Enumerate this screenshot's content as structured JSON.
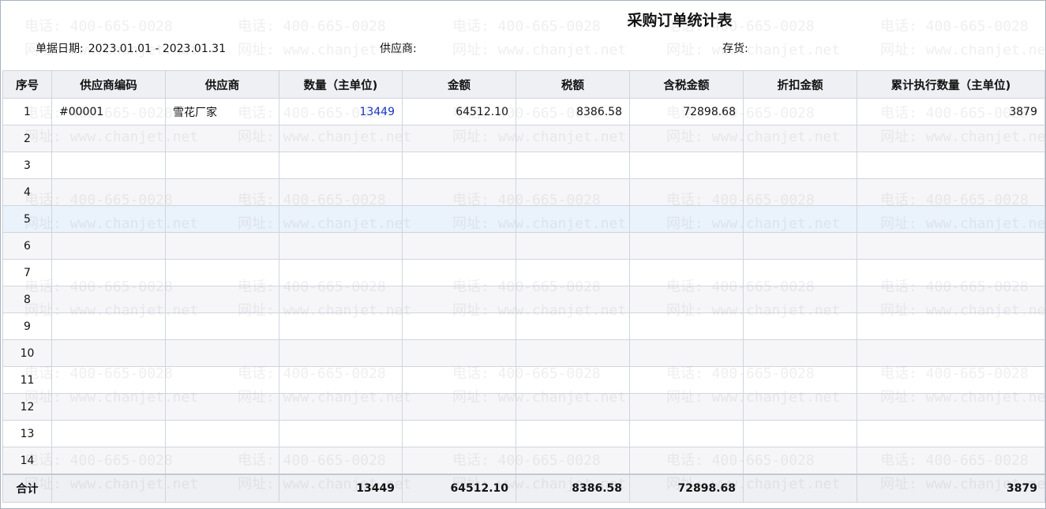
{
  "report": {
    "title": "采购订单统计表"
  },
  "filters": {
    "date_label": "单据日期:",
    "date_value": "2023.01.01 - 2023.01.31",
    "supplier_label": "供应商:",
    "supplier_value": "",
    "stock_label": "存货:",
    "stock_value": ""
  },
  "table": {
    "headers": [
      "序号",
      "供应商编码",
      "供应商",
      "数量（主单位)",
      "金额",
      "税额",
      "含税金额",
      "折扣金额",
      "累计执行数量（主单位)"
    ],
    "rows": [
      [
        "1",
        "#00001",
        "雪花厂家",
        "13449",
        "64512.10",
        "8386.58",
        "72898.68",
        "",
        "3879"
      ],
      [
        "2",
        "",
        "",
        "",
        "",
        "",
        "",
        "",
        ""
      ],
      [
        "3",
        "",
        "",
        "",
        "",
        "",
        "",
        "",
        ""
      ],
      [
        "4",
        "",
        "",
        "",
        "",
        "",
        "",
        "",
        ""
      ],
      [
        "5",
        "",
        "",
        "",
        "",
        "",
        "",
        "",
        ""
      ],
      [
        "6",
        "",
        "",
        "",
        "",
        "",
        "",
        "",
        ""
      ],
      [
        "7",
        "",
        "",
        "",
        "",
        "",
        "",
        "",
        ""
      ],
      [
        "8",
        "",
        "",
        "",
        "",
        "",
        "",
        "",
        ""
      ],
      [
        "9",
        "",
        "",
        "",
        "",
        "",
        "",
        "",
        ""
      ],
      [
        "10",
        "",
        "",
        "",
        "",
        "",
        "",
        "",
        ""
      ],
      [
        "11",
        "",
        "",
        "",
        "",
        "",
        "",
        "",
        ""
      ],
      [
        "12",
        "",
        "",
        "",
        "",
        "",
        "",
        "",
        ""
      ],
      [
        "13",
        "",
        "",
        "",
        "",
        "",
        "",
        "",
        ""
      ],
      [
        "14",
        "",
        "",
        "",
        "",
        "",
        "",
        "",
        ""
      ]
    ],
    "totals": [
      "合计",
      "",
      "",
      "13449",
      "64512.10",
      "8386.58",
      "72898.68",
      "",
      "3879"
    ]
  },
  "watermark": {
    "phone": "电话: 400-665-0028",
    "site": "网址: www.chanjet.net"
  },
  "colors": {
    "link": "#1a33c9",
    "header_bg": "#eef0f3",
    "highlight_row": "#eaf2fc",
    "border": "#cfd5dd"
  }
}
